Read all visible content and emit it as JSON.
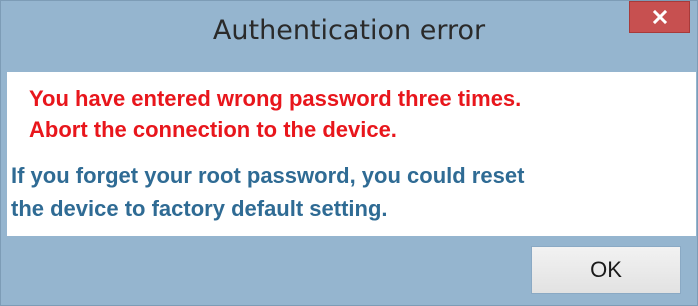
{
  "dialog": {
    "title": "Authentication error",
    "close_icon": "close-icon",
    "close_color": "#c75050",
    "error_lines": [
      "You have entered wrong password three times.",
      "Abort the connection to the device."
    ],
    "info_lines": [
      "If you forget your root password, you could reset",
      "the device to factory default setting."
    ],
    "ok_label": "OK",
    "colors": {
      "error_text": "#e8161c",
      "info_text": "#2f6b94",
      "frame": "#95b5cf"
    }
  }
}
